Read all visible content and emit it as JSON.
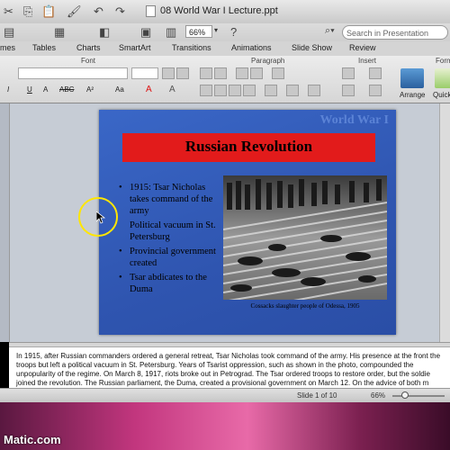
{
  "window": {
    "title": "08 World War I Lecture.ppt"
  },
  "toolbar": {
    "zoom_value": "66%",
    "search_placeholder": "Search in Presentation"
  },
  "ribbon": {
    "tabs": [
      "mes",
      "Tables",
      "Charts",
      "SmartArt",
      "Transitions",
      "Animations",
      "Slide Show",
      "Review"
    ],
    "group_labels": [
      "Font",
      "Paragraph",
      "Insert",
      "Form"
    ],
    "arrange_label": "Arrange",
    "quick_label": "Quick"
  },
  "slide": {
    "watermark": "World War I",
    "title": "Russian Revolution",
    "bullets": [
      {
        "text": "1915: Tsar Nicholas takes command of the army",
        "bullet": true
      },
      {
        "text": "Political vacuum in St. Petersburg",
        "bullet": false
      },
      {
        "text": "Provincial government created",
        "bullet": true
      },
      {
        "text": "Tsar abdicates to the Duma",
        "bullet": true
      }
    ],
    "caption": "Cossacks slaughter people of Odessa, 1905"
  },
  "notes": {
    "text": "In 1915, after Russian commanders ordered a general retreat, Tsar Nicholas took command of the army. His presence at the front the troops but left a political vacuum in St. Petersburg. Years of Tsarist oppression, such as shown in the photo, compounded the unpopularity of the regime. On March 8, 1917, riots broke out in Petrograd. The Tsar ordered troops to restore order, but the soldie joined the revolution. The Russian parliament, the Duma, created a provisional government on March 12. On the advice of both m"
  },
  "status": {
    "slide_count": "Slide 1 of 10",
    "zoom": "66%",
    "zoom_level_percent": 66
  },
  "desktop": {
    "brand": "Matic.com"
  },
  "colors": {
    "slide_background": "#2f55b0",
    "title_bar": "#e21b1b",
    "cursor_ring": "#ffe600"
  }
}
